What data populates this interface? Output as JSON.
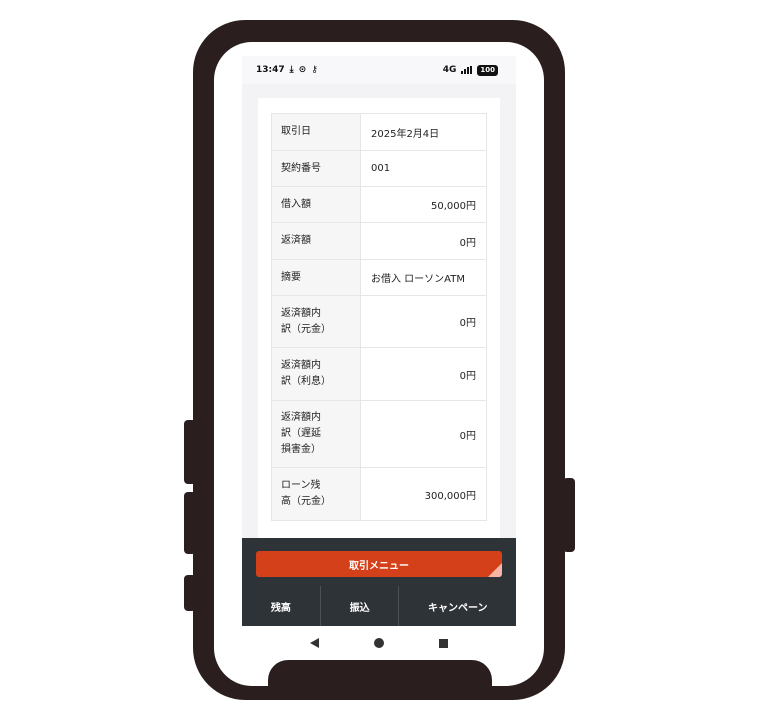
{
  "status_bar": {
    "time": "13:47",
    "network": "4G",
    "battery": "100",
    "icons": [
      "download-icon",
      "circle-icon",
      "key-icon",
      "signal-icon",
      "battery-icon"
    ]
  },
  "transaction": {
    "rows": [
      {
        "label": "取引日",
        "value": "2025年2月4日",
        "align": "left"
      },
      {
        "label": "契約番号",
        "value": "001",
        "align": "left"
      },
      {
        "label": "借入額",
        "value": "50,000円",
        "align": "right"
      },
      {
        "label": "返済額",
        "value": "0円",
        "align": "right"
      },
      {
        "label": "摘要",
        "value": "お借入 ローソンATM",
        "align": "left"
      },
      {
        "label": "返済額内訳（元金）",
        "value": "0円",
        "align": "right"
      },
      {
        "label": "返済額内訳（利息）",
        "value": "0円",
        "align": "right"
      },
      {
        "label": "返済額内訳（遅延損害金）",
        "value": "0円",
        "align": "right"
      },
      {
        "label": "ローン残高（元金）",
        "value": "300,000円",
        "align": "right"
      }
    ]
  },
  "bottom_menu": {
    "menu_button_label": "取引メニュー",
    "tabs": [
      "残高",
      "振込",
      "キャンペーン"
    ]
  },
  "nav": {
    "icons": [
      "back-icon",
      "home-icon",
      "recent-apps-icon"
    ]
  },
  "colors": {
    "accent": "#d4401a",
    "bottom_bar": "#2e3338",
    "phone_frame": "#2a1e1e"
  }
}
